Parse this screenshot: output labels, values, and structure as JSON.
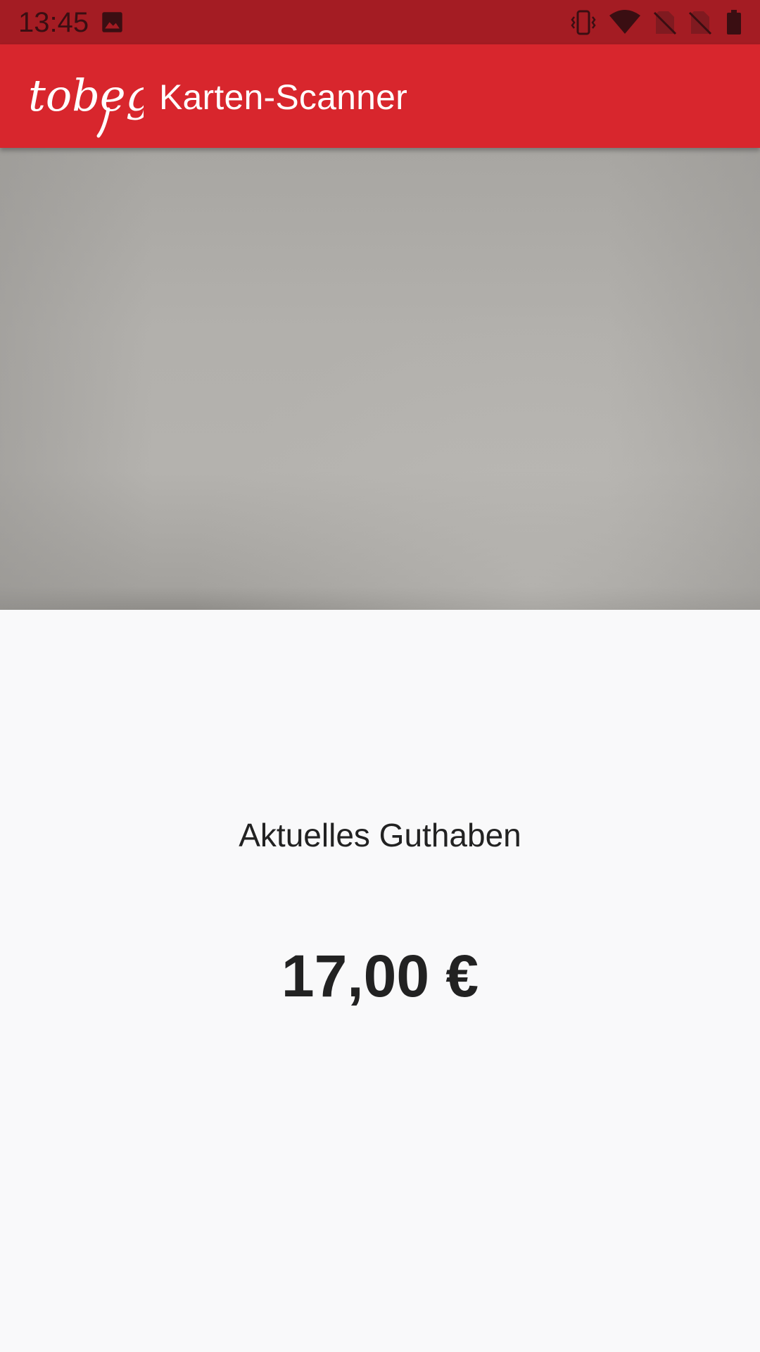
{
  "status_bar": {
    "time": "13:45",
    "icons": [
      "gallery-icon",
      "vibrate-icon",
      "wifi-icon",
      "no-sim-icon",
      "no-sim-icon",
      "battery-icon"
    ]
  },
  "app_bar": {
    "logo_text": "tobego",
    "title": "Karten-Scanner",
    "color": "#d8262d"
  },
  "camera_preview": {
    "icon": "camera-preview"
  },
  "balance": {
    "label": "Aktuelles Guthaben",
    "value": "17,00 €"
  },
  "colors": {
    "status_bar": "#a41c23",
    "app_bar": "#d8262d",
    "background": "#f9f9fa",
    "text": "#222222"
  }
}
